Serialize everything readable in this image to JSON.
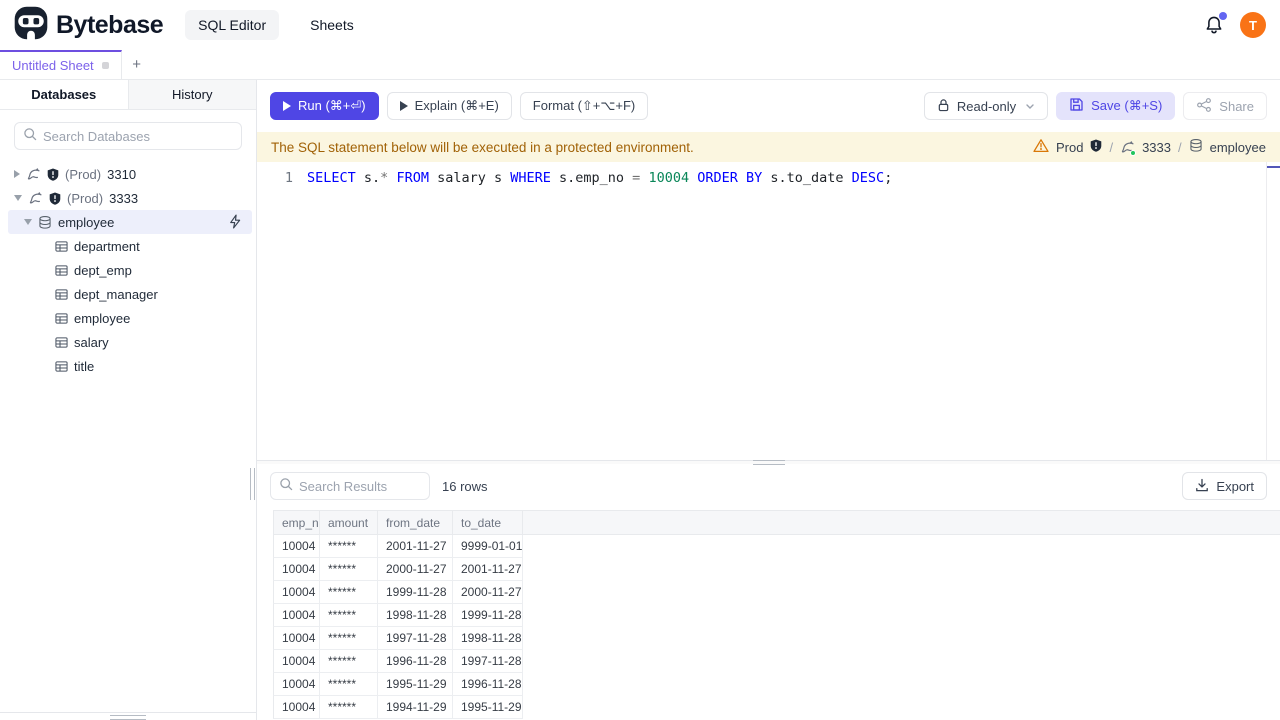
{
  "header": {
    "brand": "Bytebase",
    "nav": [
      {
        "label": "SQL Editor"
      },
      {
        "label": "Sheets"
      }
    ],
    "avatar": "T"
  },
  "tabbar": {
    "active_tab": "Untitled Sheet",
    "new_tab": "+"
  },
  "sidebar": {
    "tabs": [
      {
        "label": "Databases"
      },
      {
        "label": "History"
      }
    ],
    "search_placeholder": "Search Databases",
    "instances": [
      {
        "env": "(Prod)",
        "name": "3310"
      },
      {
        "env": "(Prod)",
        "name": "3333"
      }
    ],
    "database": "employee",
    "tables": [
      "department",
      "dept_emp",
      "dept_manager",
      "employee",
      "salary",
      "title"
    ]
  },
  "toolbar": {
    "run": "Run (⌘+⏎)",
    "explain": "Explain (⌘+E)",
    "format": "Format (⇧+⌥+F)",
    "readonly": "Read-only",
    "save": "Save (⌘+S)",
    "share": "Share"
  },
  "banner": {
    "message": "The SQL statement below will be executed in a protected environment.",
    "environment": "Prod",
    "separator": "/",
    "instance": "3333",
    "database": "employee"
  },
  "editor": {
    "line_number": "1",
    "tokens": [
      {
        "type": "keyword",
        "text": "SELECT"
      },
      {
        "type": "plain",
        "text": " s."
      },
      {
        "type": "operator",
        "text": "*"
      },
      {
        "type": "plain",
        "text": " "
      },
      {
        "type": "keyword",
        "text": "FROM"
      },
      {
        "type": "plain",
        "text": " salary s "
      },
      {
        "type": "keyword",
        "text": "WHERE"
      },
      {
        "type": "plain",
        "text": " s.emp_no "
      },
      {
        "type": "operator",
        "text": "="
      },
      {
        "type": "plain",
        "text": " "
      },
      {
        "type": "number",
        "text": "10004"
      },
      {
        "type": "plain",
        "text": " "
      },
      {
        "type": "keyword",
        "text": "ORDER BY"
      },
      {
        "type": "plain",
        "text": " s.to_date "
      },
      {
        "type": "keyword",
        "text": "DESC"
      },
      {
        "type": "plain",
        "text": ";"
      }
    ]
  },
  "results": {
    "search_placeholder": "Search Results",
    "row_count": "16 rows",
    "export": "Export",
    "columns": [
      "emp_no",
      "amount",
      "from_date",
      "to_date"
    ],
    "rows": [
      [
        "10004",
        "******",
        "2001-11-27",
        "9999-01-01"
      ],
      [
        "10004",
        "******",
        "2000-11-27",
        "2001-11-27"
      ],
      [
        "10004",
        "******",
        "1999-11-28",
        "2000-11-27"
      ],
      [
        "10004",
        "******",
        "1998-11-28",
        "1999-11-28"
      ],
      [
        "10004",
        "******",
        "1997-11-28",
        "1998-11-28"
      ],
      [
        "10004",
        "******",
        "1996-11-28",
        "1997-11-28"
      ],
      [
        "10004",
        "******",
        "1995-11-29",
        "1996-11-28"
      ],
      [
        "10004",
        "******",
        "1994-11-29",
        "1995-11-29"
      ]
    ]
  },
  "colors": {
    "accent": "#4f46e5",
    "tab_active": "#7c62ea",
    "avatar_bg": "#f97316",
    "warning_bg": "#fbf6e0",
    "warning_text": "#a16207",
    "sql_keyword": "#0000ff",
    "sql_number": "#098658",
    "sql_operator": "#717171",
    "status_green": "#22c55e",
    "selected_row_bg": "#edeffb"
  }
}
